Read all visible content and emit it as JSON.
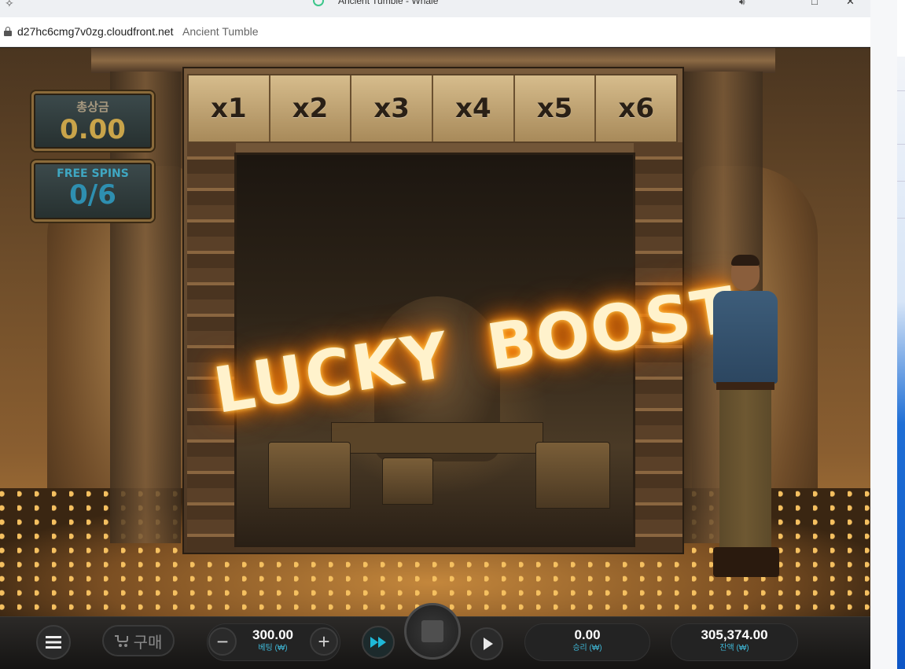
{
  "browser": {
    "window_title": "Ancient Tumble - Whale",
    "url": "d27hc6cmg7v0zg.cloudfront.net",
    "page_title": "Ancient Tumble"
  },
  "game": {
    "multipliers": [
      "x1",
      "x2",
      "x3",
      "x4",
      "x5",
      "x6"
    ],
    "total_win": {
      "label": "총상금",
      "value": "0.00"
    },
    "free_spins": {
      "label": "FREE SPINS",
      "value": "0/6"
    },
    "banner": {
      "word1": "LUCKY",
      "word2": "BOOST"
    }
  },
  "controls": {
    "buy_label": "구매",
    "bet": {
      "value": "300.00",
      "label": "베팅 (₩)"
    },
    "minus_glyph": "−",
    "plus_glyph": "+",
    "win": {
      "value": "0.00",
      "label": "승리 (₩)"
    },
    "balance": {
      "value": "305,374.00",
      "label": "잔액 (₩)"
    }
  },
  "colors": {
    "accent_cyan": "#3fb7d6",
    "gold": "#c9a44a",
    "glow_orange": "#ff9a1a"
  }
}
